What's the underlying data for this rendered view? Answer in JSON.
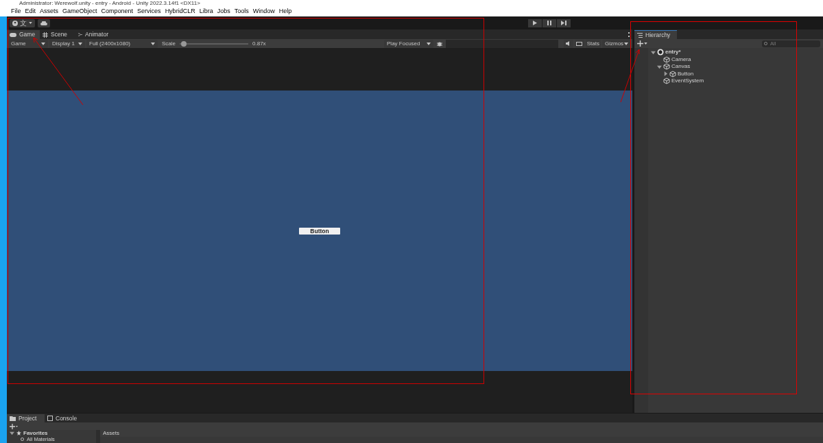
{
  "window": {
    "title": "Administrator: Werewolf.unity - entry - Android - Unity 2022.3.14f1 <DX11>"
  },
  "menu": [
    "File",
    "Edit",
    "Assets",
    "GameObject",
    "Component",
    "Services",
    "HybridCLR",
    "Libra",
    "Jobs",
    "Tools",
    "Window",
    "Help"
  ],
  "toolbar": {
    "account_label": "文"
  },
  "game_panel": {
    "tabs": [
      {
        "label": "Game",
        "selected": true,
        "kind": "game"
      },
      {
        "label": "Scene",
        "selected": false,
        "kind": "scene"
      },
      {
        "label": "Animator",
        "selected": false,
        "kind": "animator"
      }
    ],
    "toolbar": {
      "view": "Game",
      "display": "Display 1",
      "resolution": "Full (2400x1080)",
      "scale_label": "Scale",
      "scale": {
        "level": 0.02
      },
      "scale_value": "0.87x",
      "play_mode": "Play Focused",
      "stats": "Stats",
      "gizmos": "Gizmos"
    },
    "canvas_button": "Button"
  },
  "hierarchy": {
    "tab": "Hierarchy",
    "search_placeholder": "All",
    "tree": [
      {
        "label": "entry*",
        "kind": "scene",
        "expanded": true,
        "children": [
          {
            "label": "Camera",
            "kind": "object"
          },
          {
            "label": "Canvas",
            "kind": "object",
            "expanded": true,
            "children": [
              {
                "label": "Button",
                "kind": "object",
                "expanded": false
              }
            ]
          },
          {
            "label": "EventSystem",
            "kind": "object"
          }
        ]
      }
    ]
  },
  "project": {
    "tabs": [
      {
        "label": "Project",
        "selected": true,
        "kind": "folder"
      },
      {
        "label": "Console",
        "selected": false,
        "kind": "console"
      }
    ],
    "favorites": {
      "label": "Favorites",
      "expanded": true,
      "children": [
        "All Materials"
      ]
    },
    "assets_header": "Assets"
  }
}
